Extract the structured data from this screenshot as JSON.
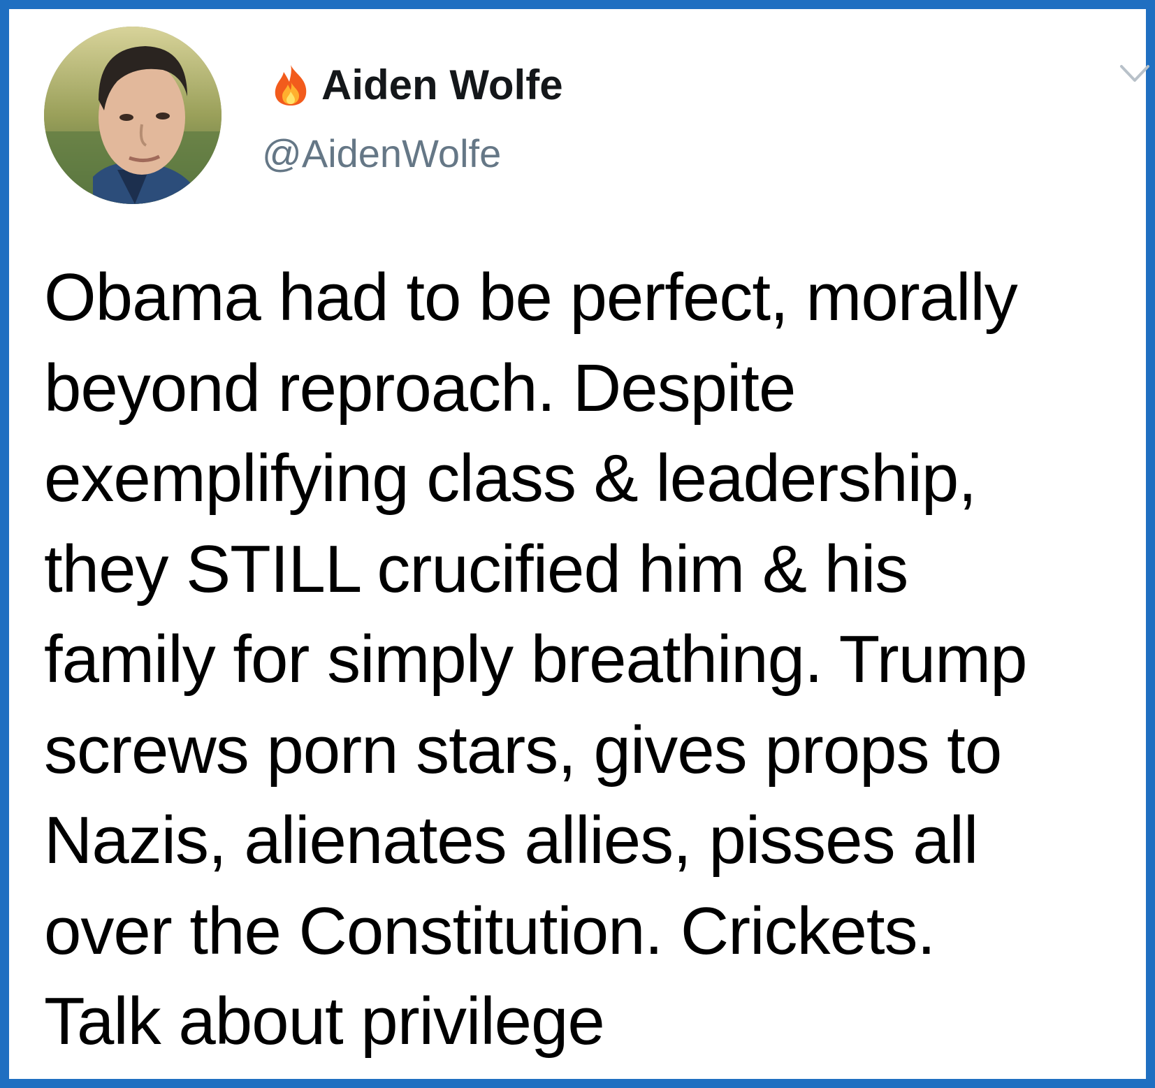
{
  "tweet": {
    "author": {
      "name_emoji": "🔥",
      "display_name": "Aiden Wolfe",
      "handle": "@AidenWolfe",
      "avatar_icon": "profile-photo"
    },
    "menu_icon": "chevron-down-icon",
    "text_lines": [
      "Obama had to be perfect, morally",
      "beyond reproach. Despite",
      "exemplifying class & leadership,",
      "they STILL crucified him & his",
      "family for simply breathing. Trump",
      "screws porn stars, gives props to",
      "Nazis, alienates allies, pisses all",
      "over the Constitution. Crickets.",
      "Talk about privilege"
    ]
  },
  "colors": {
    "frame_border": "#1f6fc1",
    "name_text": "#14171a",
    "handle_text": "#657786",
    "body_text": "#000000",
    "fire": "#f25b1c"
  }
}
